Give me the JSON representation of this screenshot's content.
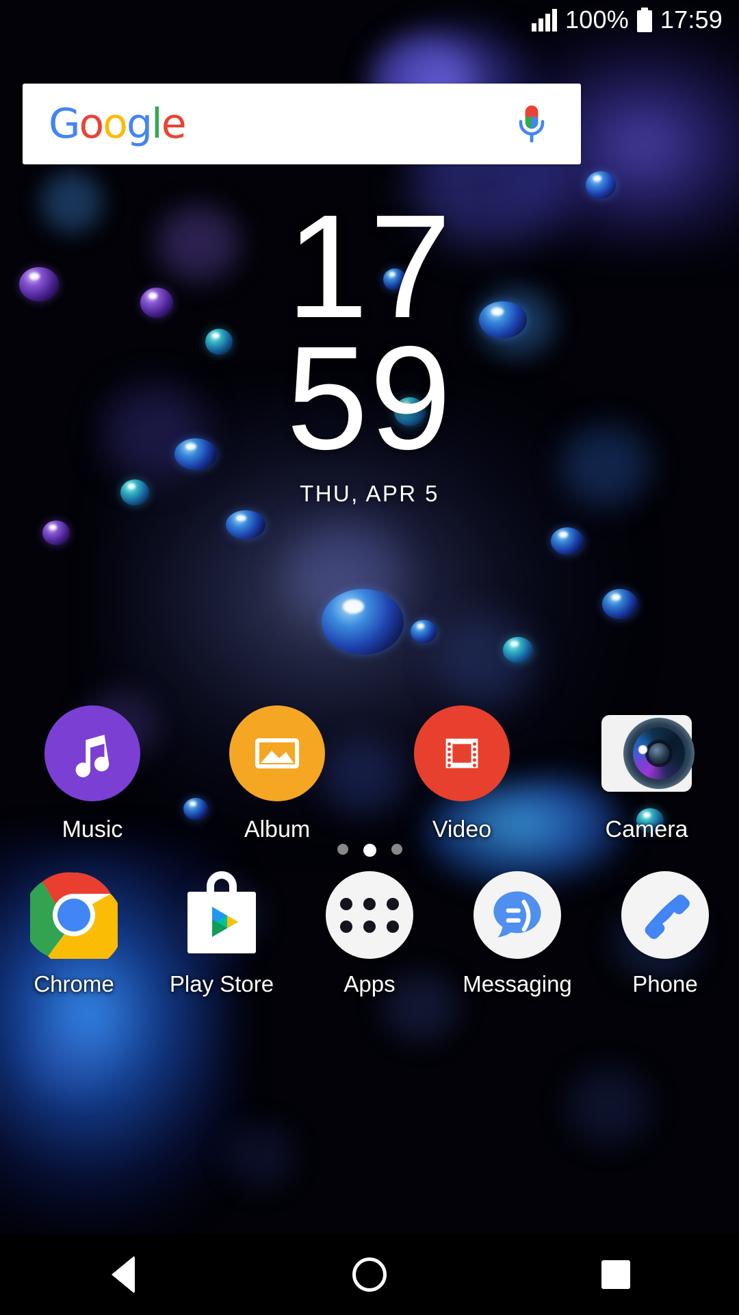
{
  "status_bar": {
    "signal_icon": "signal-bars-icon",
    "signal_bars": 4,
    "battery_percent": "100%",
    "battery_icon": "battery-full-icon",
    "clock": "17:59"
  },
  "search_bar": {
    "logo_text": "Google",
    "logo_letters": [
      {
        "char": "G",
        "color": "#4285F4"
      },
      {
        "char": "o",
        "color": "#EA4335"
      },
      {
        "char": "o",
        "color": "#FBBC05"
      },
      {
        "char": "g",
        "color": "#4285F4"
      },
      {
        "char": "l",
        "color": "#34A853"
      },
      {
        "char": "e",
        "color": "#EA4335"
      }
    ],
    "voice_icon": "microphone-icon",
    "background": "#FFFFFF"
  },
  "clock_widget": {
    "hours": "17",
    "minutes": "59",
    "date": "THU, APR 5"
  },
  "app_row": [
    {
      "label": "Music",
      "icon": "music-note-icon",
      "color": "#7B3FD4"
    },
    {
      "label": "Album",
      "icon": "photo-image-icon",
      "color": "#F5A623"
    },
    {
      "label": "Video",
      "icon": "film-strip-icon",
      "color": "#E8402E"
    },
    {
      "label": "Camera",
      "icon": "camera-lens-icon",
      "color": "#F2F2F2"
    }
  ],
  "page_indicator": {
    "total": 3,
    "active_index": 1
  },
  "dock": [
    {
      "label": "Chrome",
      "icon": "chrome-icon"
    },
    {
      "label": "Play Store",
      "icon": "play-store-icon"
    },
    {
      "label": "Apps",
      "icon": "app-drawer-icon"
    },
    {
      "label": "Messaging",
      "icon": "messaging-bubble-icon"
    },
    {
      "label": "Phone",
      "icon": "phone-handset-icon"
    }
  ],
  "nav_bar": [
    {
      "name": "back",
      "icon": "triangle-back-icon"
    },
    {
      "name": "home",
      "icon": "circle-home-icon"
    },
    {
      "name": "recents",
      "icon": "square-recents-icon"
    }
  ],
  "theme": {
    "accent_blue": "#4285F4",
    "wallpaper_base": "#020208"
  }
}
